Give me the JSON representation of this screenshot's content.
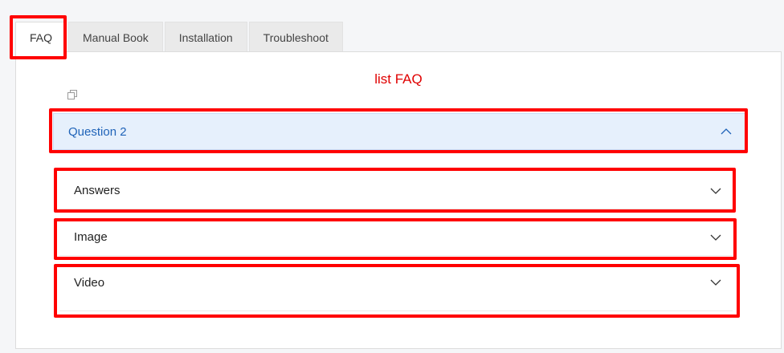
{
  "tabs": [
    {
      "label": "FAQ",
      "active": true
    },
    {
      "label": "Manual Book",
      "active": false
    },
    {
      "label": "Installation",
      "active": false
    },
    {
      "label": "Troubleshoot",
      "active": false
    }
  ],
  "panel": {
    "title": "list FAQ",
    "question": {
      "label": "Question 2",
      "expanded": true
    },
    "sections": [
      {
        "label": "Answers",
        "expanded": false
      },
      {
        "label": "Image",
        "expanded": false
      },
      {
        "label": "Video",
        "expanded": false
      }
    ]
  },
  "colors": {
    "highlight": "#ff0000",
    "title": "#e00000",
    "question_text": "#1f63b8",
    "question_bg": "#e6f0fc"
  },
  "icons": {
    "copy": "copy-icon",
    "collapse": "chevron-up-icon",
    "expand": "chevron-down-icon"
  }
}
